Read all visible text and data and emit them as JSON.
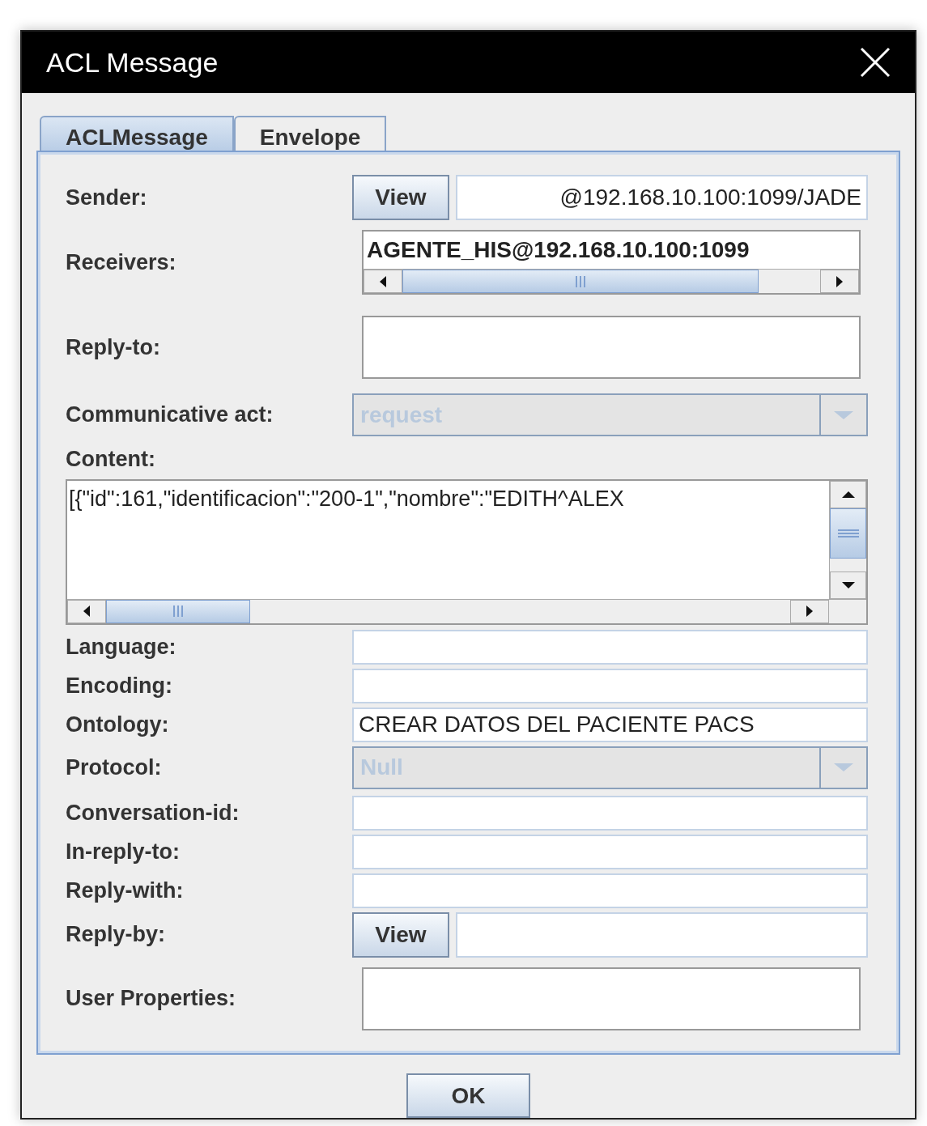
{
  "window": {
    "title": "ACL Message"
  },
  "tabs": [
    {
      "label": "ACLMessage",
      "selected": true
    },
    {
      "label": "Envelope",
      "selected": false
    }
  ],
  "fields": [
    {
      "kind": "address",
      "label": "Sender:",
      "button": "View",
      "value": "@192.168.10.100:1099/JADE"
    },
    {
      "kind": "list",
      "label": "Receivers:",
      "value": "AGENTE_HIS@192.168.10.100:1099"
    },
    {
      "kind": "box",
      "label": "Reply-to:"
    },
    {
      "kind": "combo",
      "label": "Communicative act:",
      "value": "request",
      "disabled": true
    },
    {
      "kind": "textarea",
      "label": "Content:",
      "value": "[{\"id\":161,\"identificacion\":\"200-1\",\"nombre\":\"EDITH^ALEX"
    },
    {
      "kind": "field",
      "label": "Language:"
    },
    {
      "kind": "field",
      "label": "Encoding:"
    },
    {
      "kind": "field",
      "label": "Ontology:",
      "value": "CREAR DATOS DEL PACIENTE PACS"
    },
    {
      "kind": "combo",
      "label": "Protocol:",
      "value": "Null",
      "disabled": true
    },
    {
      "kind": "field",
      "label": "Conversation-id:"
    },
    {
      "kind": "field",
      "label": "In-reply-to:"
    },
    {
      "kind": "field",
      "label": "Reply-with:"
    },
    {
      "kind": "address",
      "label": "Reply-by:",
      "button": "View"
    },
    {
      "kind": "box",
      "label": "User Properties:"
    }
  ],
  "buttons": [
    "OK"
  ]
}
